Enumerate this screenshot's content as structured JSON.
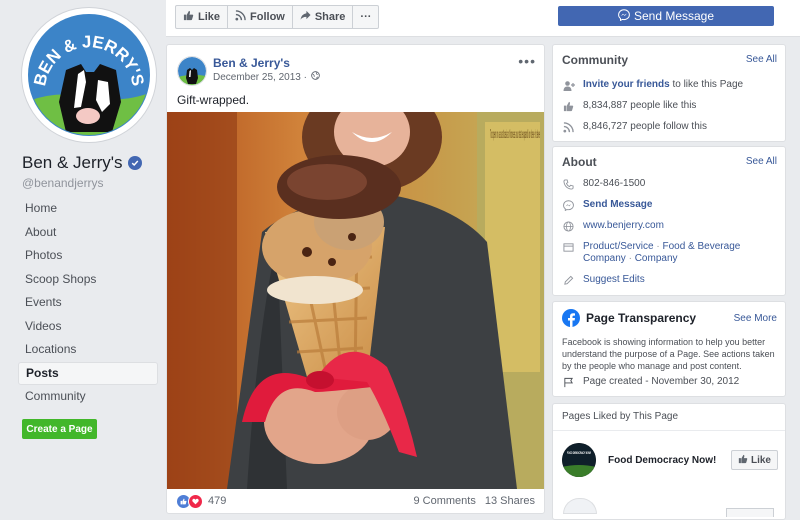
{
  "sidebar": {
    "logo_text": "BEN & JERRY'S",
    "page_name": "Ben & Jerry's",
    "handle": "@benandjerrys",
    "nav": [
      "Home",
      "About",
      "Photos",
      "Scoop Shops",
      "Events",
      "Videos",
      "Locations",
      "Posts",
      "Community"
    ],
    "active_nav": "Posts",
    "create_page": "Create a Page"
  },
  "actionbar": {
    "like": "Like",
    "follow": "Follow",
    "share": "Share",
    "more": "···",
    "send_message": "Send Message"
  },
  "post": {
    "author": "Ben & Jerry's",
    "date": "December 25, 2013 ·",
    "text": "Gift-wrapped.",
    "photo_text": "To open on a sust basis of increas our stat expandi ior deve ir deve",
    "reaction_count": "479",
    "comments": "9 Comments",
    "shares": "13 Shares"
  },
  "community": {
    "title": "Community",
    "see_all": "See All",
    "invite_link": "Invite your friends",
    "invite_suffix": "to like this Page",
    "likes": "8,834,887 people like this",
    "follows": "8,846,727 people follow this"
  },
  "about": {
    "title": "About",
    "see_all": "See All",
    "phone": "802-846-1500",
    "send_message": "Send Message",
    "website": "www.benjerry.com",
    "category_1": "Product/Service",
    "category_2": "Food & Beverage Company",
    "category_3": "Company",
    "suggest": "Suggest Edits"
  },
  "transparency": {
    "title": "Page Transparency",
    "see_more": "See More",
    "desc": "Facebook is showing information to help you better understand the purpose of a Page. See actions taken by the people who manage and post content.",
    "created": "Page created - November 30, 2012"
  },
  "liked": {
    "title": "Pages Liked by This Page",
    "page_name": "Food Democracy Now!",
    "thumb_text": "FOOD DEMOCRACY NOW!",
    "like": "Like"
  },
  "colors": {
    "brand_blue": "#4267b2",
    "link": "#385898",
    "green": "#42b72a",
    "background": "#e9ebee"
  }
}
